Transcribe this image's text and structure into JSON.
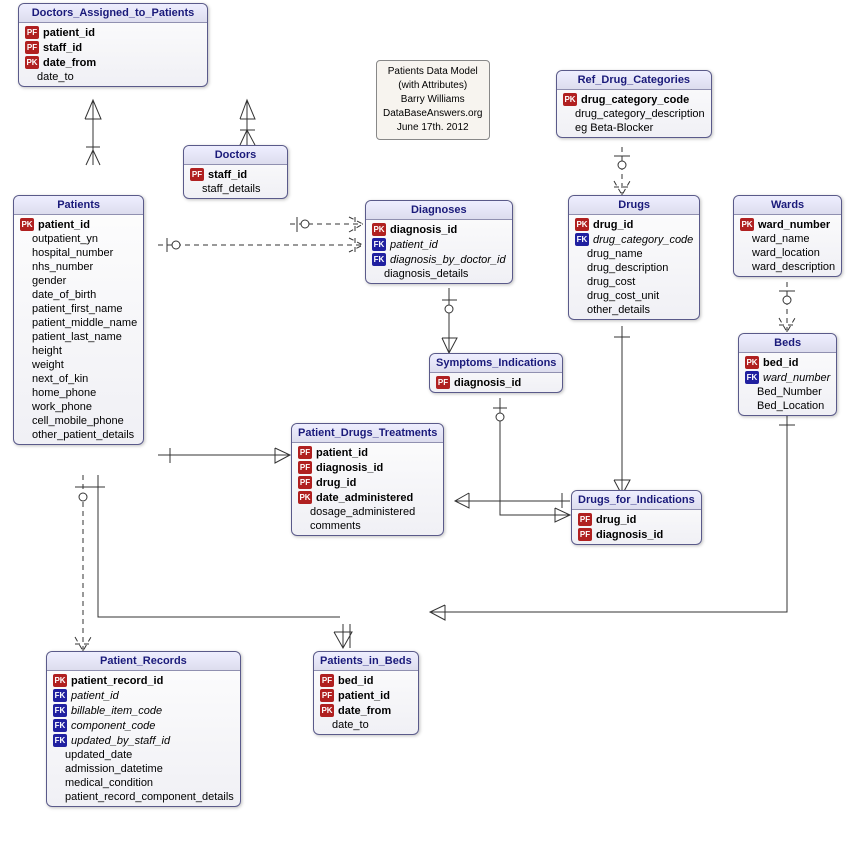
{
  "note": {
    "l1": "Patients Data Model",
    "l2": "(with Attributes)",
    "l3": "Barry Williams",
    "l4": "DataBaseAnswers.org",
    "l5": "June 17th. 2012"
  },
  "e": {
    "doctors_assigned": {
      "title": "Doctors_Assigned_to_Patients",
      "rows": [
        {
          "k": "PF",
          "t": "patient_id",
          "b": 1
        },
        {
          "k": "PF",
          "t": "staff_id",
          "b": 1
        },
        {
          "k": "PK",
          "t": "date_from",
          "b": 1
        },
        {
          "t": "date_to"
        }
      ]
    },
    "doctors": {
      "title": "Doctors",
      "rows": [
        {
          "k": "PF",
          "t": "staff_id",
          "b": 1
        },
        {
          "t": "staff_details"
        }
      ]
    },
    "patients": {
      "title": "Patients",
      "rows": [
        {
          "k": "PK",
          "t": "patient_id",
          "b": 1
        },
        {
          "t": "outpatient_yn"
        },
        {
          "t": "hospital_number"
        },
        {
          "t": "nhs_number"
        },
        {
          "t": "gender"
        },
        {
          "t": "date_of_birth"
        },
        {
          "t": "patient_first_name"
        },
        {
          "t": "patient_middle_name"
        },
        {
          "t": "patient_last_name"
        },
        {
          "t": "height"
        },
        {
          "t": "weight"
        },
        {
          "t": "next_of_kin"
        },
        {
          "t": "home_phone"
        },
        {
          "t": "work_phone"
        },
        {
          "t": "cell_mobile_phone"
        },
        {
          "t": "other_patient_details"
        }
      ]
    },
    "ref_drug": {
      "title": "Ref_Drug_Categories",
      "rows": [
        {
          "k": "PK",
          "t": "drug_category_code",
          "b": 1
        },
        {
          "t": "drug_category_description"
        },
        {
          "t": "eg Beta-Blocker"
        }
      ]
    },
    "diagnoses": {
      "title": "Diagnoses",
      "rows": [
        {
          "k": "PK",
          "t": "diagnosis_id",
          "b": 1
        },
        {
          "k": "FK",
          "t": "patient_id",
          "i": 1
        },
        {
          "k": "FK",
          "t": "diagnosis_by_doctor_id",
          "i": 1
        },
        {
          "t": "diagnosis_details"
        }
      ]
    },
    "drugs": {
      "title": "Drugs",
      "rows": [
        {
          "k": "PK",
          "t": "drug_id",
          "b": 1
        },
        {
          "k": "FK",
          "t": "drug_category_code",
          "i": 1
        },
        {
          "t": "drug_name"
        },
        {
          "t": "drug_description"
        },
        {
          "t": "drug_cost"
        },
        {
          "t": "drug_cost_unit"
        },
        {
          "t": "other_details"
        }
      ]
    },
    "wards": {
      "title": "Wards",
      "rows": [
        {
          "k": "PK",
          "t": "ward_number",
          "b": 1
        },
        {
          "t": "ward_name"
        },
        {
          "t": "ward_location"
        },
        {
          "t": "ward_description"
        }
      ]
    },
    "symptoms": {
      "title": "Symptoms_Indications",
      "rows": [
        {
          "k": "PF",
          "t": "diagnosis_id",
          "b": 1
        }
      ]
    },
    "beds": {
      "title": "Beds",
      "rows": [
        {
          "k": "PK",
          "t": "bed_id",
          "b": 1
        },
        {
          "k": "FK",
          "t": "ward_number",
          "i": 1
        },
        {
          "t": "Bed_Number"
        },
        {
          "t": "Bed_Location"
        }
      ]
    },
    "pdt": {
      "title": "Patient_Drugs_Treatments",
      "rows": [
        {
          "k": "PF",
          "t": "patient_id",
          "b": 1
        },
        {
          "k": "PF",
          "t": "diagnosis_id",
          "b": 1
        },
        {
          "k": "PF",
          "t": "drug_id",
          "b": 1
        },
        {
          "k": "PK",
          "t": "date_administered",
          "b": 1
        },
        {
          "t": "dosage_administered"
        },
        {
          "t": "comments"
        }
      ]
    },
    "dfi": {
      "title": "Drugs_for_Indications",
      "rows": [
        {
          "k": "PF",
          "t": "drug_id",
          "b": 1
        },
        {
          "k": "PF",
          "t": "diagnosis_id",
          "b": 1
        }
      ]
    },
    "pib": {
      "title": "Patients_in_Beds",
      "rows": [
        {
          "k": "PF",
          "t": "bed_id",
          "b": 1
        },
        {
          "k": "PF",
          "t": "patient_id",
          "b": 1
        },
        {
          "k": "PK",
          "t": "date_from",
          "b": 1
        },
        {
          "t": "date_to"
        }
      ]
    },
    "precords": {
      "title": "Patient_Records",
      "rows": [
        {
          "k": "PK",
          "t": "patient_record_id",
          "b": 1
        },
        {
          "k": "FK",
          "t": "patient_id",
          "i": 1
        },
        {
          "k": "FK",
          "t": "billable_item_code",
          "i": 1
        },
        {
          "k": "FK",
          "t": "component_code",
          "i": 1
        },
        {
          "k": "FK",
          "t": "updated_by_staff_id",
          "i": 1
        },
        {
          "t": "updated_date"
        },
        {
          "t": "admission_datetime"
        },
        {
          "t": "medical_condition"
        },
        {
          "t": "patient_record_component_details"
        }
      ]
    }
  }
}
